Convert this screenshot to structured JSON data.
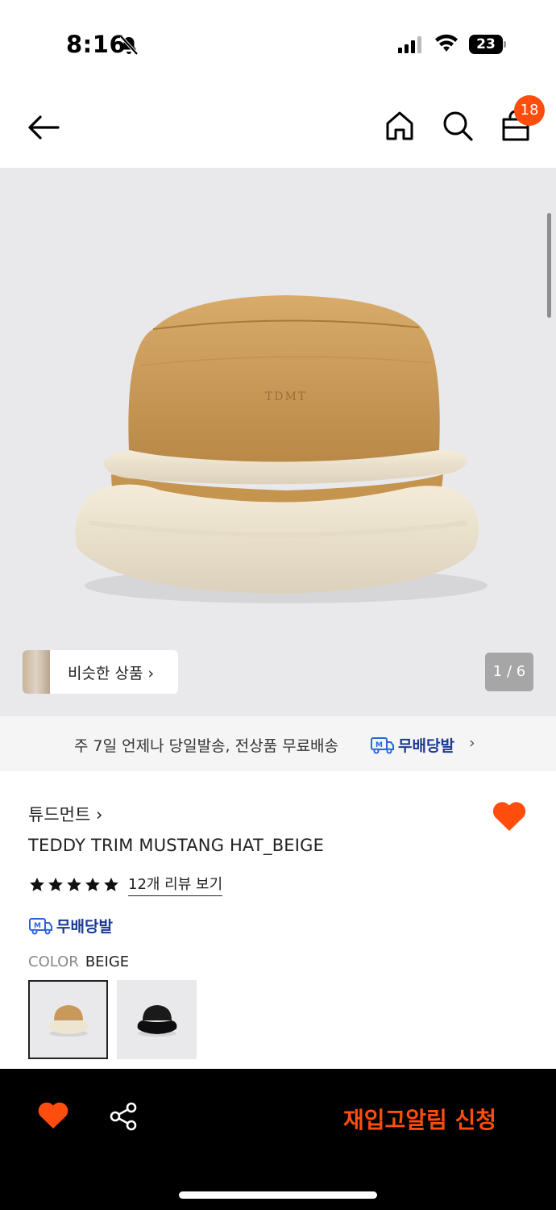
{
  "status_bar": {
    "time": "8:16",
    "battery": "23"
  },
  "header": {
    "cart_count": "18"
  },
  "gallery": {
    "similar_label": "비슷한 상품 ›",
    "counter": "1 / 6"
  },
  "shipping_banner": {
    "text": "주 7일 언제나 당일발송, 전상품 무료배송",
    "logo_text": "무배당발",
    "chevron": "›"
  },
  "product": {
    "brand": "튜드먼트 ›",
    "title": "TEDDY TRIM MUSTANG HAT_BEIGE",
    "rating_stars": 5,
    "review_link": "12개 리뷰 보기",
    "badge_text": "무배당발",
    "color_label": "COLOR",
    "color_value": "BEIGE",
    "hat_logo": "TDMT"
  },
  "bottom_bar": {
    "cta": "재입고알림 신청"
  },
  "colors": {
    "accent": "#ff4d0d",
    "navy": "#1b3a94",
    "image_bg": "#e9e9eb"
  }
}
